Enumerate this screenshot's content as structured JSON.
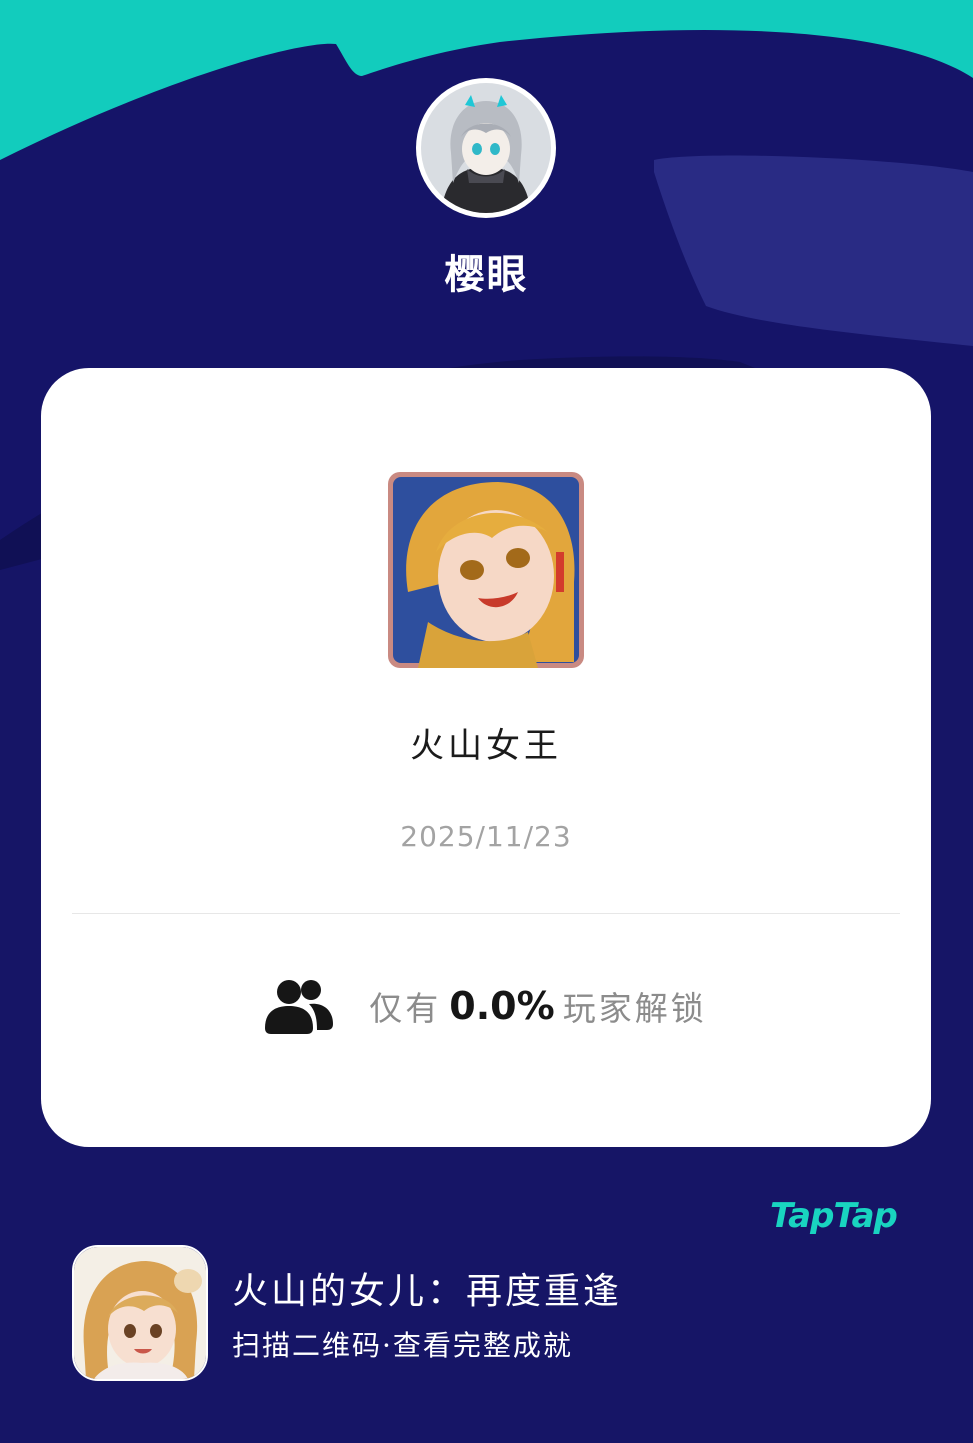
{
  "profile": {
    "username": "樱眼",
    "avatar": "anime-avatar-silver-hair"
  },
  "achievement": {
    "icon": "volcano-queen-portrait",
    "title": "火山女王",
    "date": "2025/11/23",
    "rarity_prefix": "仅有",
    "rarity_percent": "0.0%",
    "rarity_suffix": "玩家解锁",
    "rarity_icon": "users-icon"
  },
  "brand": {
    "logo_text": "TapTap",
    "accent": "#19d4c0"
  },
  "game": {
    "icon": "game-icon-girl-portrait",
    "name": "火山的女儿：再度重逢",
    "subtitle": "扫描二维码·查看完整成就"
  },
  "colors": {
    "background": "#161566",
    "top_band": "#12ccbd",
    "card": "#ffffff"
  }
}
